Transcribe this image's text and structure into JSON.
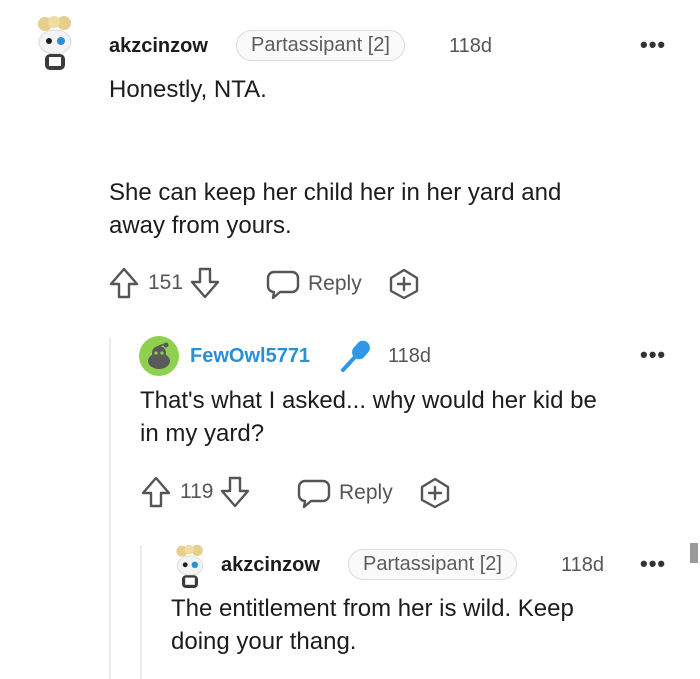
{
  "comments": [
    {
      "username": "akzcinzow",
      "flair": "Partassipant [2]",
      "time": "118d",
      "paragraph1": "Honestly, NTA.",
      "paragraph2": "She can keep her child her in her yard and\naway from yours.",
      "votes": "151",
      "reply_label": "Reply"
    },
    {
      "username": "FewOwl5771",
      "time": "118d",
      "text": "That's what I asked... why would her kid be\nin my yard?",
      "votes": "119",
      "reply_label": "Reply"
    },
    {
      "username": "akzcinzow",
      "flair": "Partassipant [2]",
      "time": "118d",
      "text": "The entitlement from her is wild. Keep\ndoing your thang."
    }
  ],
  "more_options": "•••",
  "icons": [
    "snoo-avatar-icon",
    "microphone-icon",
    "upvote-icon",
    "downvote-icon",
    "comment-bubble-icon",
    "award-icon",
    "more-options-icon"
  ],
  "colors": {
    "op_username": "#2b8fd6",
    "op_mic": "#2f97e6"
  }
}
